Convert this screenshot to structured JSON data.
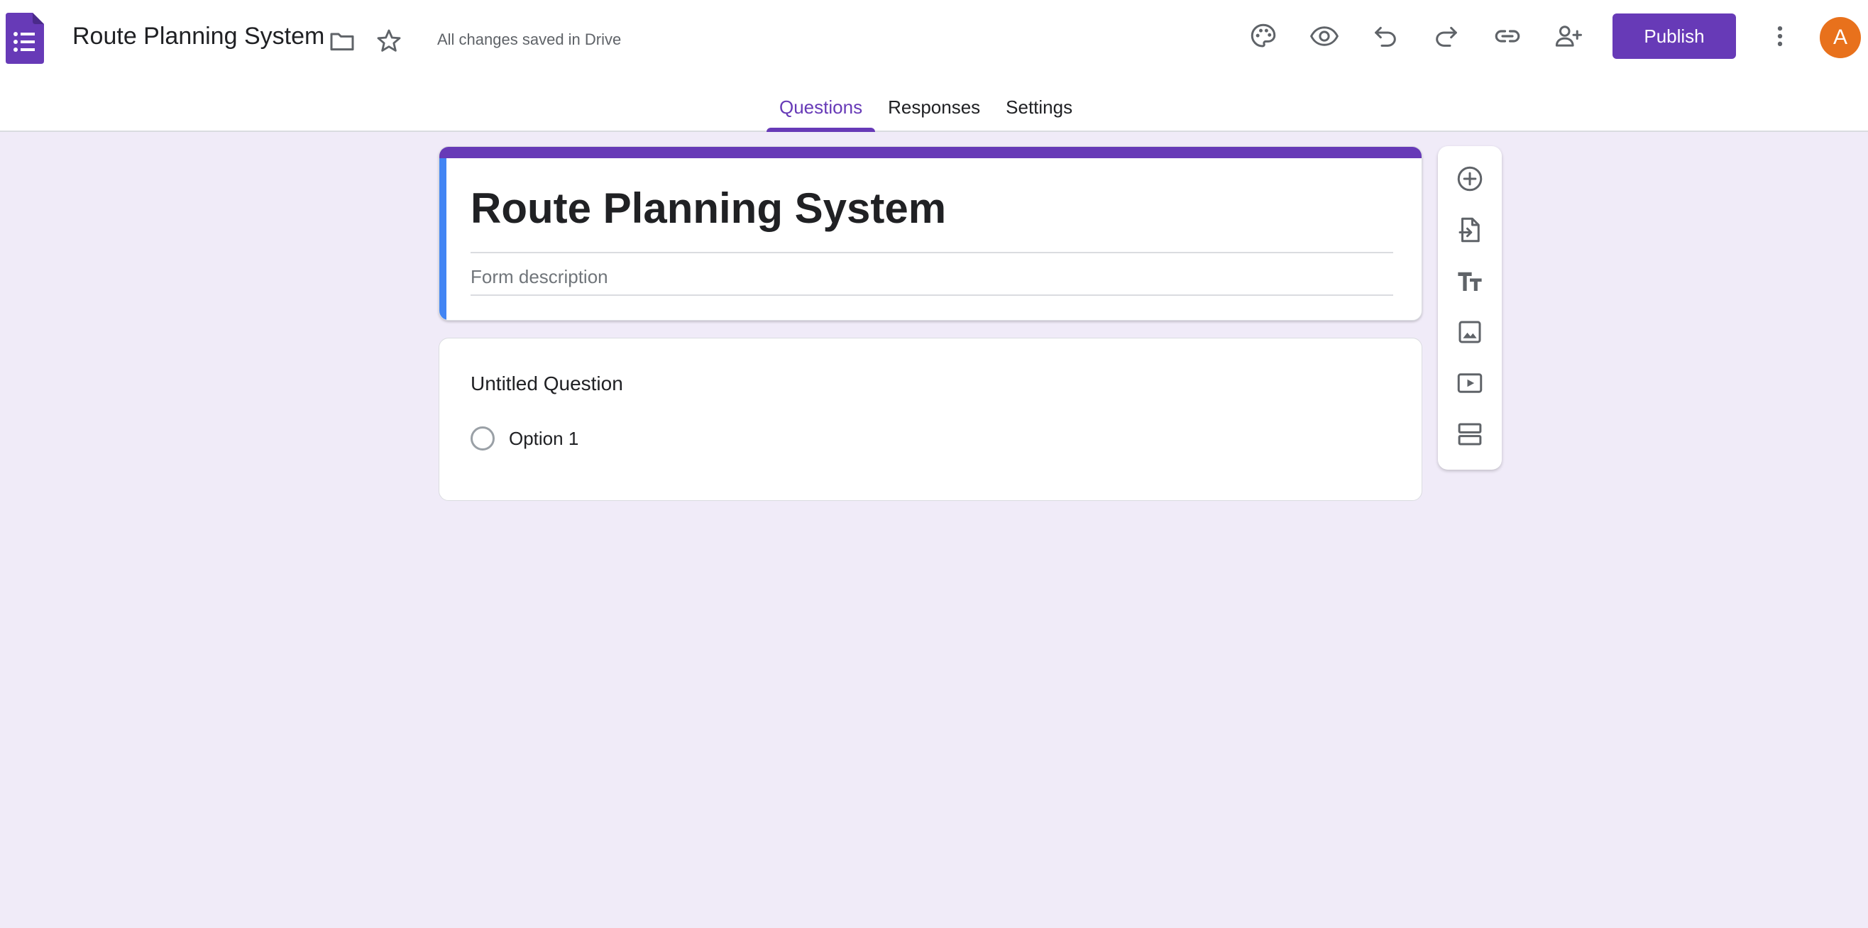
{
  "header": {
    "doc_title": "Route Planning System",
    "save_status": "All changes saved in Drive",
    "publish_label": "Publish",
    "avatar_initial": "A",
    "icons": [
      "forms-logo-icon",
      "folder-icon",
      "star-icon",
      "palette-icon",
      "eye-icon",
      "undo-icon",
      "redo-icon",
      "link-icon",
      "add-person-icon",
      "more-vert-icon"
    ]
  },
  "tabs": [
    {
      "label": "Questions",
      "active": true
    },
    {
      "label": "Responses",
      "active": false
    },
    {
      "label": "Settings",
      "active": false
    }
  ],
  "form": {
    "title": "Route Planning System",
    "description_placeholder": "Form description"
  },
  "question": {
    "title": "Untitled Question",
    "options": [
      "Option 1"
    ]
  },
  "toolbar": {
    "icons": [
      "add-question-icon",
      "import-questions-icon",
      "add-title-icon",
      "add-image-icon",
      "add-video-icon",
      "add-section-icon"
    ]
  },
  "colors": {
    "accent": "#673ab7",
    "background": "#f0ebf8",
    "left_bar": "#4285f4",
    "avatar": "#e8711c"
  }
}
